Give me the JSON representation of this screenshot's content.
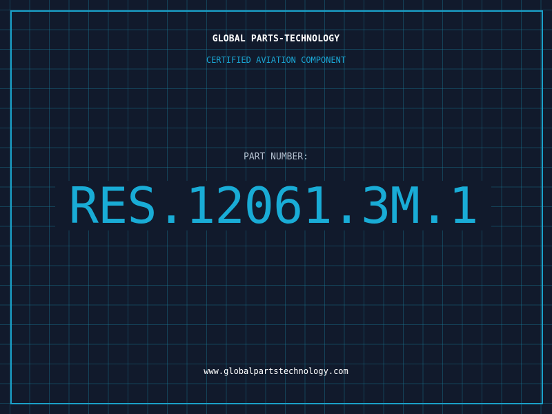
{
  "badge": {
    "company": "GLOBAL PARTS-TECHNOLOGY",
    "subtitle": "CERTIFIED AVIATION COMPONENT",
    "part_label": "PART NUMBER:",
    "part_number": "RES.12061.3M.1",
    "website": "www.globalpartstechnology.com"
  },
  "colors": {
    "background": "#111a2c",
    "accent": "#1aa7d6",
    "grid": "#1c7ea0",
    "text": "#ffffff",
    "muted_text": "#b4c0cf"
  }
}
